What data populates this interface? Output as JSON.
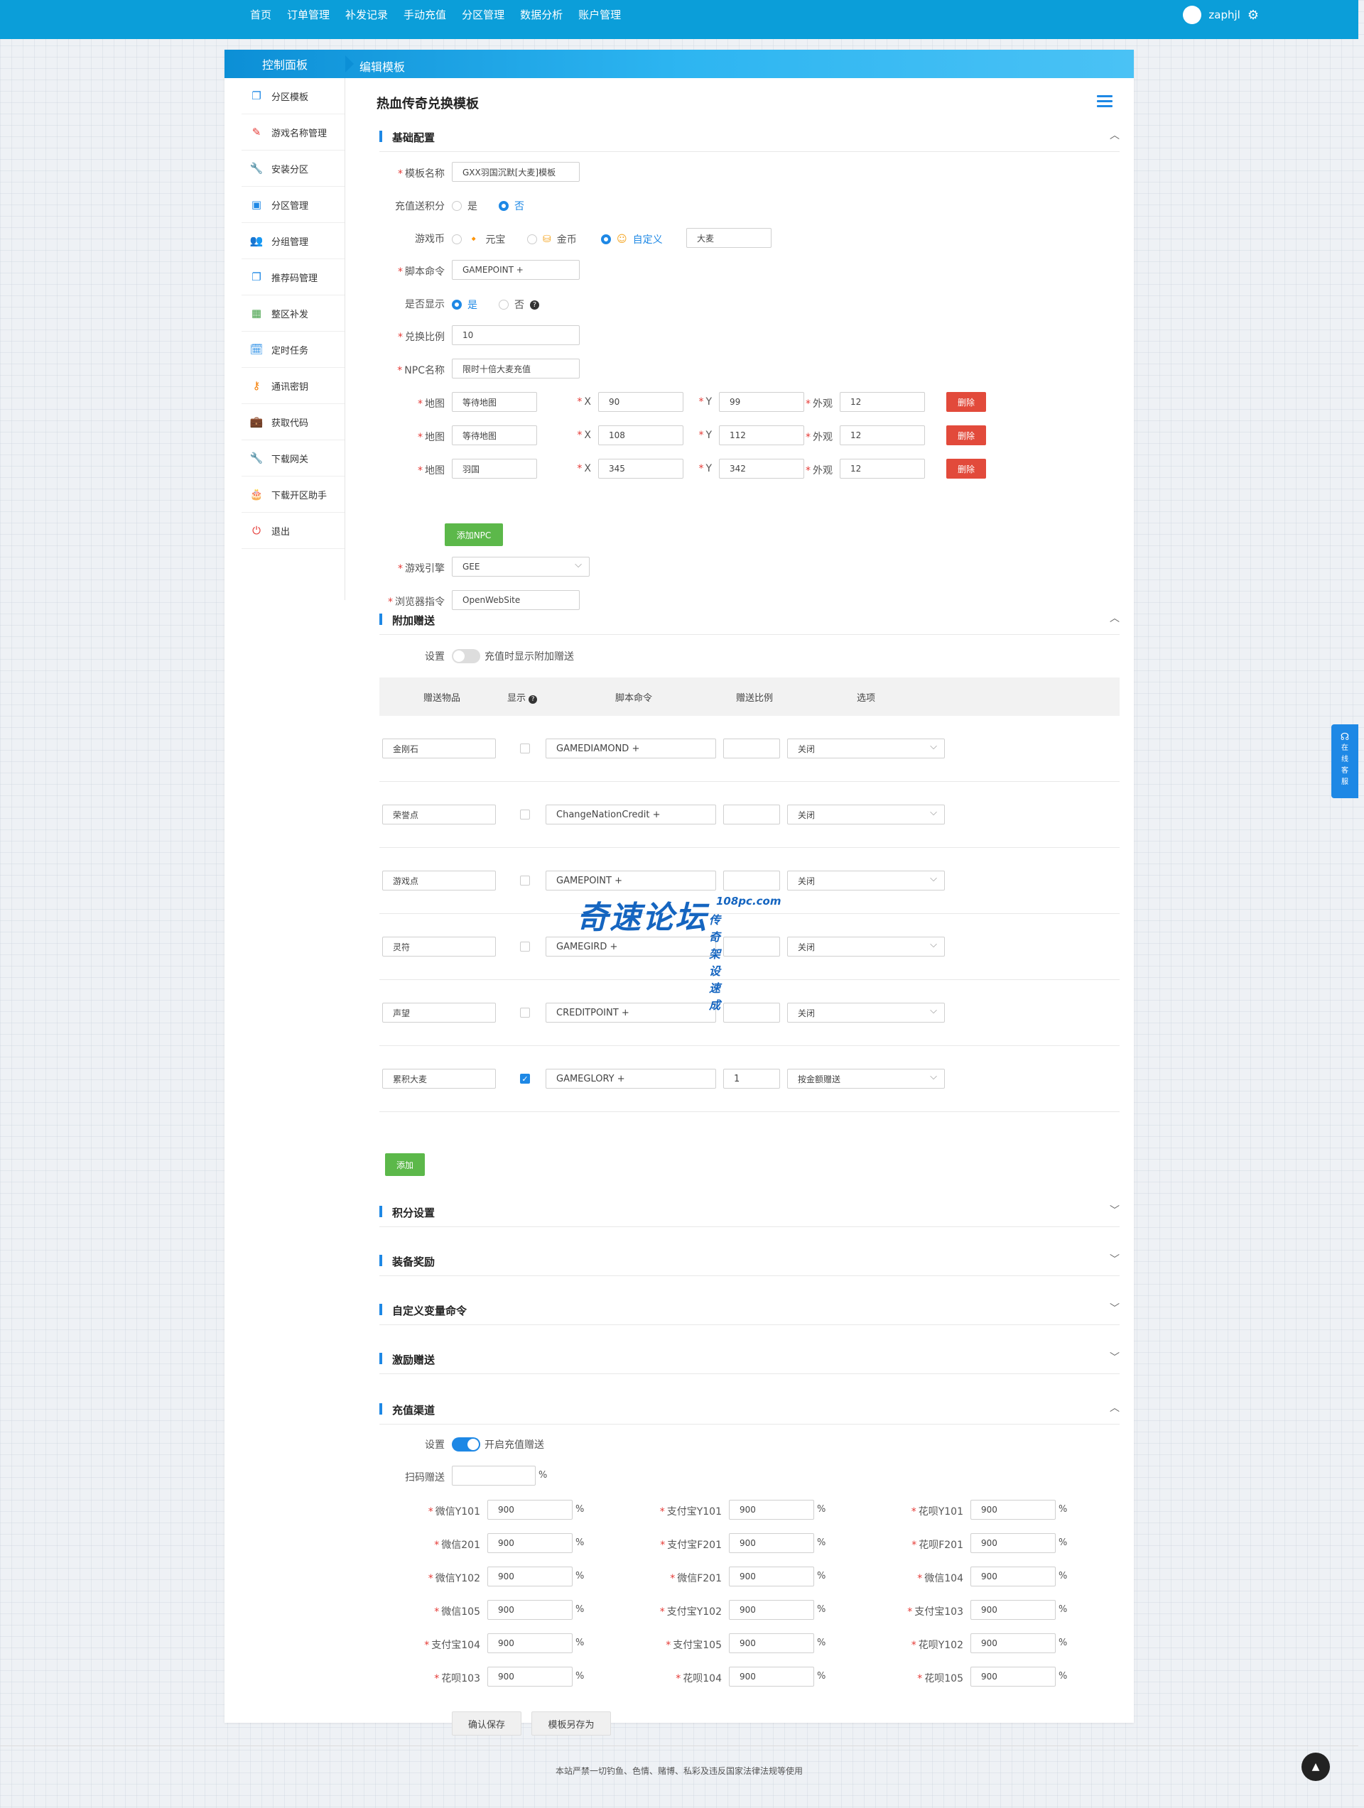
{
  "topnav": {
    "items": [
      "首页",
      "订单管理",
      "补发记录",
      "手动充值",
      "分区管理",
      "数据分析",
      "账户管理"
    ],
    "username": "zaphjl"
  },
  "header": {
    "control_panel": "控制面板",
    "edit_tab": "编辑模板"
  },
  "sidebar": {
    "items": [
      {
        "label": "分区模板",
        "icon": "copy-icon",
        "color": "#1e88e5"
      },
      {
        "label": "游戏名称管理",
        "icon": "pencil-icon",
        "color": "#e53935"
      },
      {
        "label": "安装分区",
        "icon": "wrench-icon",
        "color": "#43a047"
      },
      {
        "label": "分区管理",
        "icon": "inbox-icon",
        "color": "#1e88e5"
      },
      {
        "label": "分组管理",
        "icon": "users-icon",
        "color": "#43a047"
      },
      {
        "label": "推荐码管理",
        "icon": "copy-icon",
        "color": "#1e88e5"
      },
      {
        "label": "整区补发",
        "icon": "calendar-icon",
        "color": "#43a047"
      },
      {
        "label": "定时任务",
        "icon": "schedule-icon",
        "color": "#1e88e5"
      },
      {
        "label": "通讯密钥",
        "icon": "key-icon",
        "color": "#f57c00"
      },
      {
        "label": "获取代码",
        "icon": "briefcase-icon",
        "color": "#43a047"
      },
      {
        "label": "下载网关",
        "icon": "wrench-icon",
        "color": "#43a047"
      },
      {
        "label": "下载开区助手",
        "icon": "cake-icon",
        "color": "#d81b60"
      },
      {
        "label": "退出",
        "icon": "power-icon",
        "color": "#e53935"
      }
    ]
  },
  "page_title": "热血传奇兑换模板",
  "sections": {
    "basic": "基础配置",
    "extra": "附加赠送",
    "points": "积分设置",
    "equip": "装备奖励",
    "custom_var": "自定义变量命令",
    "incentive": "激励赠送",
    "channel": "充值渠道"
  },
  "basic": {
    "template_name_label": "模板名称",
    "template_name": "GXX羽国沉默[大麦]模板",
    "recharge_points_label": "充值送积分",
    "yes": "是",
    "no": "否",
    "currency_label": "游戏币",
    "currency_opts": [
      "元宝",
      "金币",
      "自定义"
    ],
    "currency_custom": "大麦",
    "script_label": "脚本命令",
    "script": "GAMEPOINT +",
    "display_label": "是否显示",
    "ratio_label": "兑换比例",
    "ratio": "10",
    "npc_label": "NPC名称",
    "npc": "限时十倍大麦充值",
    "map_label": "地图",
    "x_label": "X",
    "y_label": "Y",
    "look_label": "外观",
    "delete": "删除",
    "npcs": [
      {
        "map": "等待地图",
        "x": "90",
        "y": "99",
        "look": "12"
      },
      {
        "map": "等待地图",
        "x": "108",
        "y": "112",
        "look": "12"
      },
      {
        "map": "羽国",
        "x": "345",
        "y": "342",
        "look": "12"
      }
    ],
    "add_npc": "添加NPC",
    "engine_label": "游戏引擎",
    "engine": "GEE",
    "browser_label": "浏览器指令",
    "browser": "OpenWebSite"
  },
  "extra": {
    "setting_label": "设置",
    "toggle_text": "充值时显示附加赠送",
    "columns": [
      "赠送物品",
      "显示",
      "脚本命令",
      "赠送比例",
      "选项"
    ],
    "rows": [
      {
        "item": "金刚石",
        "checked": false,
        "cmd": "GAMEDIAMOND +",
        "ratio": "",
        "opt": "关闭"
      },
      {
        "item": "荣誉点",
        "checked": false,
        "cmd": "ChangeNationCredit +",
        "ratio": "",
        "opt": "关闭"
      },
      {
        "item": "游戏点",
        "checked": false,
        "cmd": "GAMEPOINT +",
        "ratio": "",
        "opt": "关闭"
      },
      {
        "item": "灵符",
        "checked": false,
        "cmd": "GAMEGIRD +",
        "ratio": "",
        "opt": "关闭"
      },
      {
        "item": "声望",
        "checked": false,
        "cmd": "CREDITPOINT +",
        "ratio": "",
        "opt": "关闭"
      },
      {
        "item": "累积大麦",
        "checked": true,
        "cmd": "GAMEGLORY +",
        "ratio": "1",
        "opt": "按金额赠送"
      }
    ],
    "add": "添加"
  },
  "channel": {
    "setting_label": "设置",
    "toggle_text": "开启充值赠送",
    "scan_label": "扫码赠送",
    "scan_value": "",
    "pct": "%",
    "rows": [
      [
        {
          "label": "微信Y101",
          "value": "900"
        },
        {
          "label": "支付宝Y101",
          "value": "900"
        },
        {
          "label": "花呗Y101",
          "value": "900"
        }
      ],
      [
        {
          "label": "微信201",
          "value": "900"
        },
        {
          "label": "支付宝F201",
          "value": "900"
        },
        {
          "label": "花呗F201",
          "value": "900"
        }
      ],
      [
        {
          "label": "微信Y102",
          "value": "900"
        },
        {
          "label": "微信F201",
          "value": "900"
        },
        {
          "label": "微信104",
          "value": "900"
        }
      ],
      [
        {
          "label": "微信105",
          "value": "900"
        },
        {
          "label": "支付宝Y102",
          "value": "900"
        },
        {
          "label": "支付宝103",
          "value": "900"
        }
      ],
      [
        {
          "label": "支付宝104",
          "value": "900"
        },
        {
          "label": "支付宝105",
          "value": "900"
        },
        {
          "label": "花呗Y102",
          "value": "900"
        }
      ],
      [
        {
          "label": "花呗103",
          "value": "900"
        },
        {
          "label": "花呗104",
          "value": "900"
        },
        {
          "label": "花呗105",
          "value": "900"
        }
      ]
    ]
  },
  "actions": {
    "save": "确认保存",
    "save_as": "模板另存为"
  },
  "footer": "本站严禁一切钓鱼、色情、赌博、私彩及违反国家法律法规等使用",
  "kefu": [
    "在",
    "线",
    "客",
    "服"
  ],
  "watermark": {
    "main": "奇速论坛",
    "site": "108pc.com",
    "sub": "传奇架设速成"
  }
}
